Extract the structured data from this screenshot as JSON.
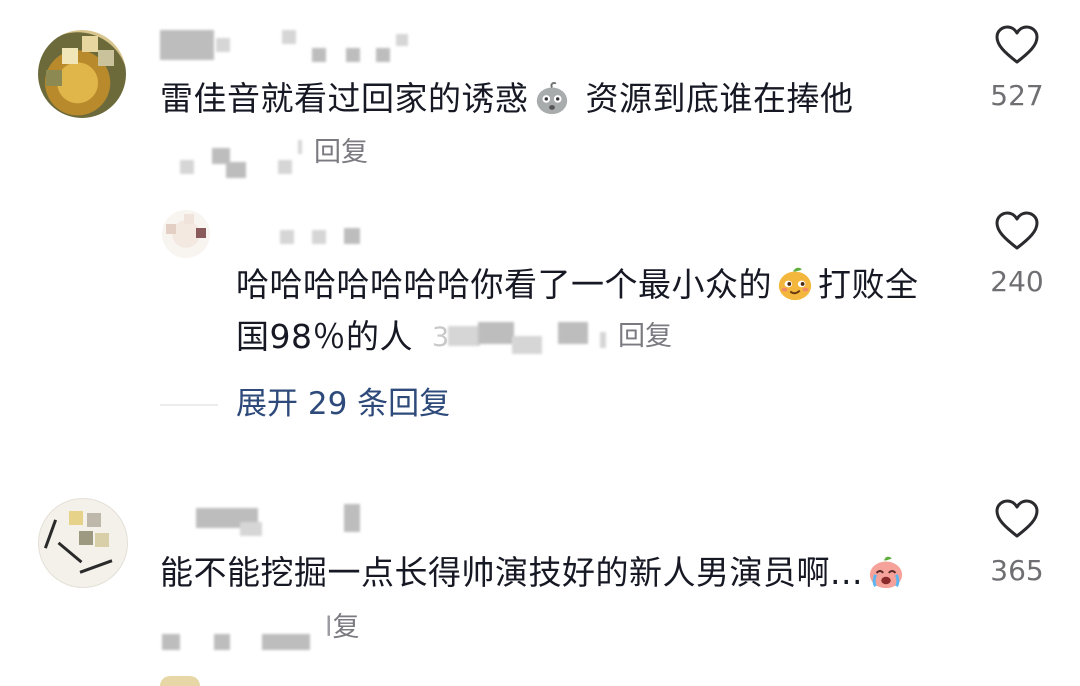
{
  "comments": [
    {
      "text_before": "雷佳音就看过回家的诱惑",
      "emoji": "frightened-face-emoji",
      "text_after": " 资源到底谁在捧他",
      "reply_label": "回复",
      "likes": "527"
    },
    {
      "text_line1_before": "哈哈哈哈哈哈哈你看了一个最小众的",
      "emoji": "smirking-mango-emoji",
      "text_line1_after": "打败全",
      "text_line2": "国98％的人",
      "meta_prefix": "3",
      "reply_label": "回复",
      "likes": "240"
    },
    {
      "text": "能不能挖掘一点长得帅演技好的新人男演员啊...",
      "emoji": "crying-peach-emoji",
      "reply_label": "复",
      "reply_prefix": "l",
      "likes": "365"
    }
  ],
  "expand_replies": "展开 29 条回复",
  "icons": {
    "like": "heart-outline-icon"
  },
  "colors": {
    "text": "#161823",
    "secondary": "#7a7a80",
    "link": "#2e4a7a"
  }
}
